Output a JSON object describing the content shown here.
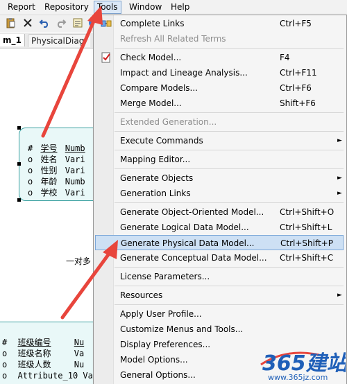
{
  "menubar": {
    "items": [
      "Report",
      "Repository",
      "Tools",
      "Window",
      "Help"
    ],
    "active": "Tools"
  },
  "tabs": [
    "m_1",
    "PhysicalDiagr"
  ],
  "canvas": {
    "entity1": {
      "rows": [
        {
          "marker": "#",
          "name": "学号",
          "type": "Numb"
        },
        {
          "marker": "o",
          "name": "姓名",
          "type": "Vari"
        },
        {
          "marker": "o",
          "name": "性别",
          "type": "Vari"
        },
        {
          "marker": "o",
          "name": "年龄",
          "type": "Numb"
        },
        {
          "marker": "o",
          "name": "学校",
          "type": "Vari"
        }
      ]
    },
    "relation_label": "一对多",
    "entity2": {
      "rows": [
        {
          "marker": "#",
          "name": "班级编号",
          "type": "Nu"
        },
        {
          "marker": "o",
          "name": "班级名称",
          "type": "Va"
        },
        {
          "marker": "o",
          "name": "班级人数",
          "type": "Nu"
        },
        {
          "marker": "o",
          "name": "Attribute_10",
          "type": "Va"
        }
      ]
    }
  },
  "menu": {
    "items": [
      {
        "label": "Complete Links",
        "shortcut": "Ctrl+F5"
      },
      {
        "label": "Refresh All Related Terms",
        "shortcut": ""
      },
      {
        "label": "Check Model...",
        "shortcut": "F4"
      },
      {
        "label": "Impact and Lineage Analysis...",
        "shortcut": "Ctrl+F11"
      },
      {
        "label": "Compare Models...",
        "shortcut": "Ctrl+F6"
      },
      {
        "label": "Merge Model...",
        "shortcut": "Shift+F6"
      },
      {
        "label": "Extended Generation...",
        "shortcut": ""
      },
      {
        "label": "Execute Commands",
        "shortcut": ""
      },
      {
        "label": "Mapping Editor...",
        "shortcut": ""
      },
      {
        "label": "Generate Objects",
        "shortcut": ""
      },
      {
        "label": "Generation Links",
        "shortcut": ""
      },
      {
        "label": "Generate Object-Oriented Model...",
        "shortcut": "Ctrl+Shift+O"
      },
      {
        "label": "Generate Logical Data Model...",
        "shortcut": "Ctrl+Shift+L"
      },
      {
        "label": "Generate Physical Data Model...",
        "shortcut": "Ctrl+Shift+P"
      },
      {
        "label": "Generate Conceptual Data Model...",
        "shortcut": "Ctrl+Shift+C"
      },
      {
        "label": "License Parameters...",
        "shortcut": ""
      },
      {
        "label": "Resources",
        "shortcut": ""
      },
      {
        "label": "Apply User Profile...",
        "shortcut": ""
      },
      {
        "label": "Customize Menus and Tools...",
        "shortcut": ""
      },
      {
        "label": "Display Preferences...",
        "shortcut": ""
      },
      {
        "label": "Model Options...",
        "shortcut": ""
      },
      {
        "label": "General Options...",
        "shortcut": ""
      }
    ],
    "submenu_arrow": "►"
  },
  "watermark": {
    "logo_text": "365建站",
    "url": "www.365jz.com"
  },
  "colors": {
    "highlight_bg": "#cde0f4",
    "highlight_border": "#7ba7d8",
    "entity_fill": "#e9f8f8",
    "entity_border": "#39a0a0",
    "annotation_arrow": "#e8453c",
    "watermark_blue": "#1f5fb8"
  },
  "icons": [
    "paste-icon",
    "delete-icon",
    "undo-icon",
    "redo-icon",
    "properties-icon",
    "complete-links-icon",
    "check-model-icon"
  ]
}
